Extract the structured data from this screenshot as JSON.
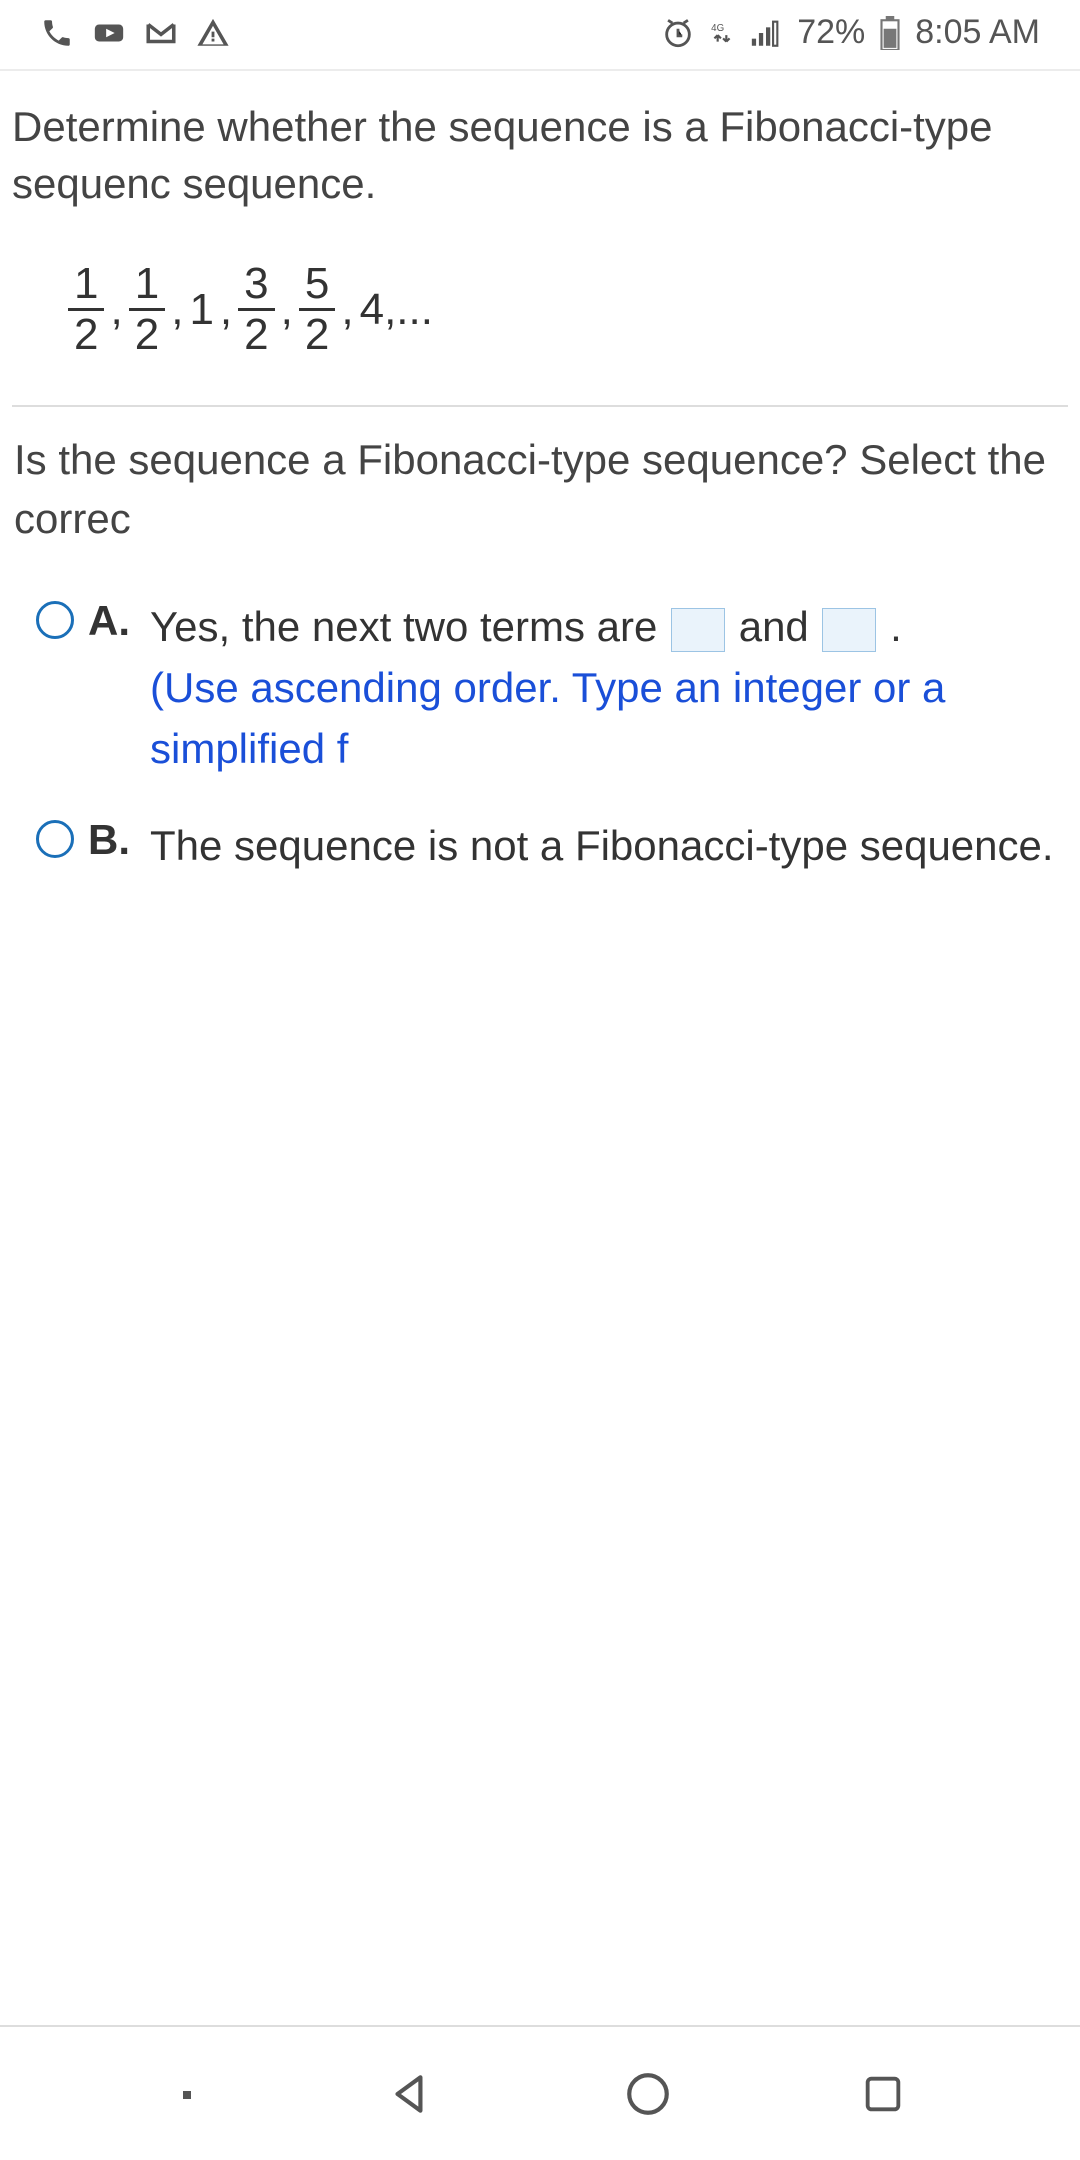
{
  "status": {
    "battery": "72%",
    "time": "8:05 AM"
  },
  "question": {
    "intro": "Determine whether the sequence is a Fibonacci-type sequenc sequence.",
    "sequence_parts": {
      "f1_num": "1",
      "f1_den": "2",
      "f2_num": "1",
      "f2_den": "2",
      "t3": "1",
      "f4_num": "3",
      "f4_den": "2",
      "f5_num": "5",
      "f5_den": "2",
      "t6": "4",
      "tail": ",..."
    },
    "prompt": "Is the sequence a Fibonacci-type sequence? Select the correc"
  },
  "options": {
    "a": {
      "letter": "A.",
      "text_before": "Yes, the next two terms are ",
      "text_mid": " and ",
      "text_after": " .",
      "hint": "(Use ascending order. Type an integer or a simplified f"
    },
    "b": {
      "letter": "B.",
      "text": "The sequence is not a Fibonacci-type sequence."
    }
  }
}
